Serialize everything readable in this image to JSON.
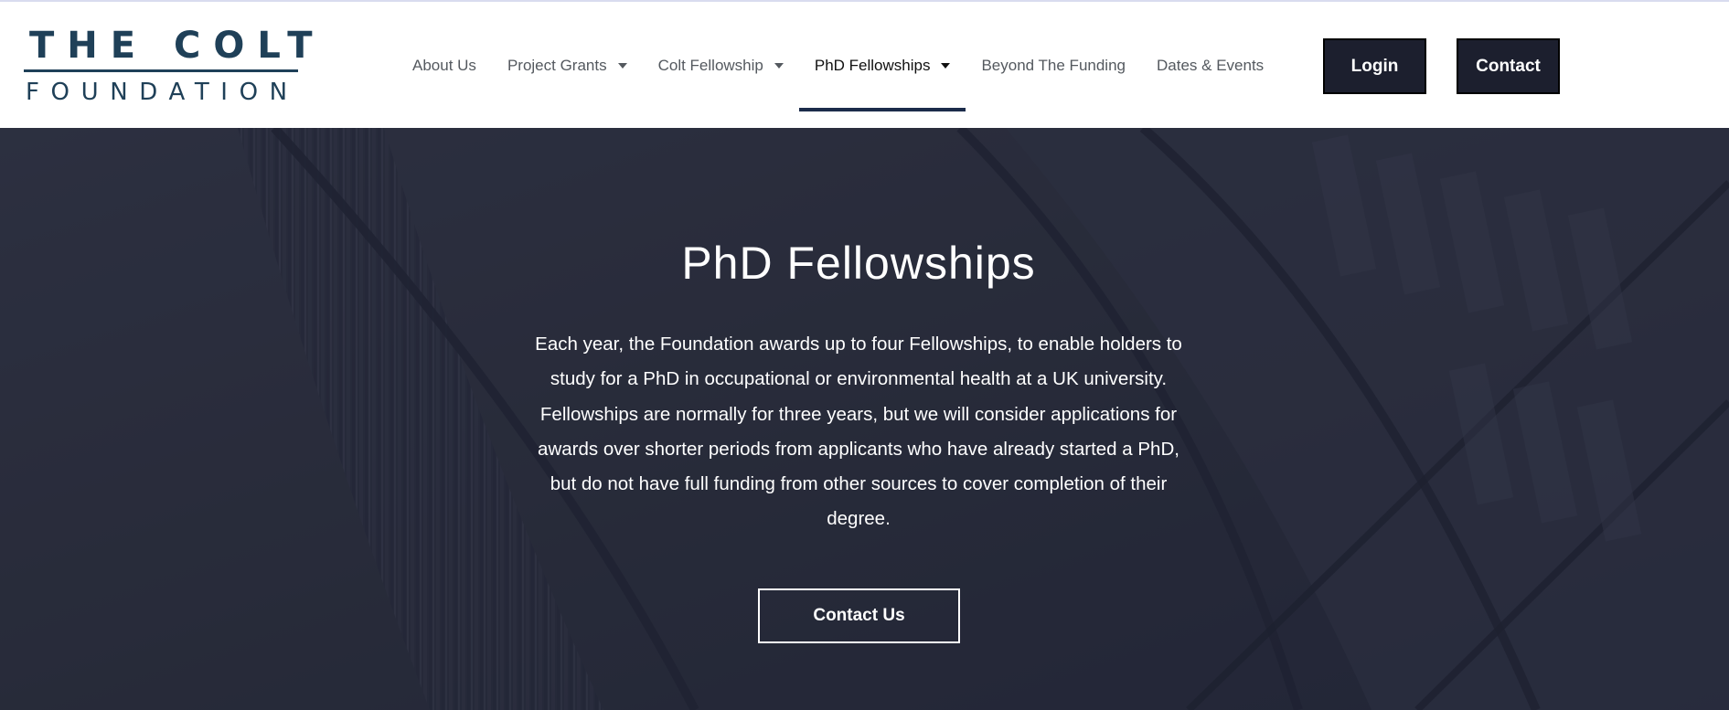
{
  "logo": {
    "line1": "THE COLT",
    "line2": "FOUNDATION",
    "color": "#1f4058"
  },
  "nav": {
    "items": [
      {
        "label": "About Us",
        "has_dropdown": false,
        "active": false
      },
      {
        "label": "Project Grants",
        "has_dropdown": true,
        "active": false
      },
      {
        "label": "Colt Fellowship",
        "has_dropdown": true,
        "active": false
      },
      {
        "label": "PhD Fellowships",
        "has_dropdown": true,
        "active": true
      },
      {
        "label": "Beyond The Funding",
        "has_dropdown": false,
        "active": false
      },
      {
        "label": "Dates & Events",
        "has_dropdown": false,
        "active": false
      }
    ],
    "active_indicator_color": "#1b2b4a"
  },
  "header_buttons": {
    "login_label": "Login",
    "contact_label": "Contact",
    "background": "#1c1f2e"
  },
  "hero": {
    "title": "PhD Fellowships",
    "body": "Each year, the Foundation awards up to four Fellowships, to enable holders to study for a PhD in occupational or environmental health at a UK university. Fellowships are normally for three years, but we will consider applications for awards over shorter periods from applicants who have already started a PhD, but do not have full funding from other sources to cover completion of their degree.",
    "cta_label": "Contact Us",
    "background_image": "library-bookshelves-image",
    "overlay_color": "#212434"
  }
}
